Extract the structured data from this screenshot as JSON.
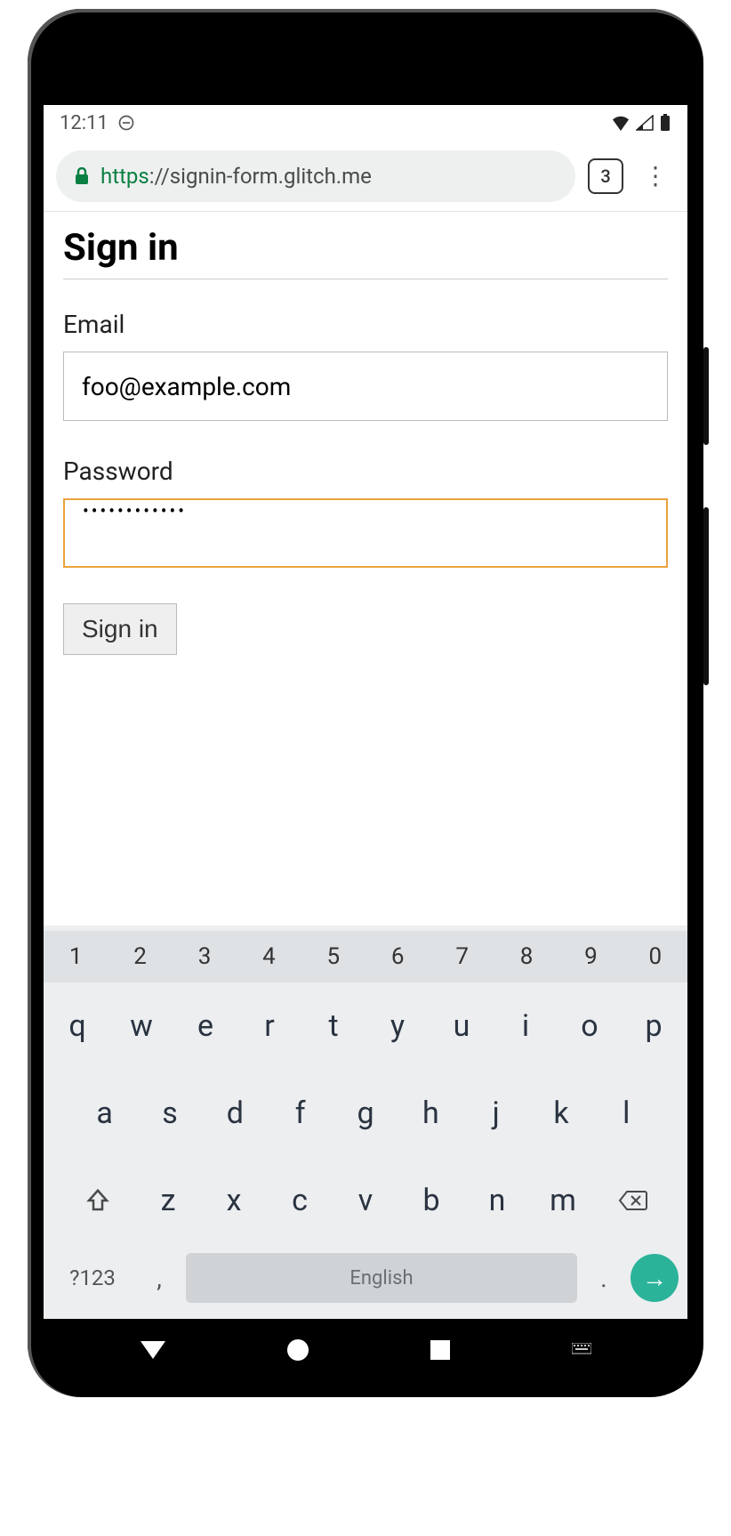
{
  "status": {
    "time": "12:11",
    "tabs_count": "3"
  },
  "browser": {
    "url_scheme": "https",
    "url_sep": "://",
    "url_host": "signin-form.glitch.me"
  },
  "form": {
    "title": "Sign in",
    "email_label": "Email",
    "email_value": "foo@example.com",
    "password_label": "Password",
    "password_value": "••••••••••••",
    "submit_label": "Sign in"
  },
  "keyboard": {
    "numbers": [
      "1",
      "2",
      "3",
      "4",
      "5",
      "6",
      "7",
      "8",
      "9",
      "0"
    ],
    "row1": [
      "q",
      "w",
      "e",
      "r",
      "t",
      "y",
      "u",
      "i",
      "o",
      "p"
    ],
    "row2": [
      "a",
      "s",
      "d",
      "f",
      "g",
      "h",
      "j",
      "k",
      "l"
    ],
    "row3": [
      "z",
      "x",
      "c",
      "v",
      "b",
      "n",
      "m"
    ],
    "symbols_label": "?123",
    "comma": ",",
    "space_label": "English",
    "period": ".",
    "enter_glyph": "→"
  }
}
